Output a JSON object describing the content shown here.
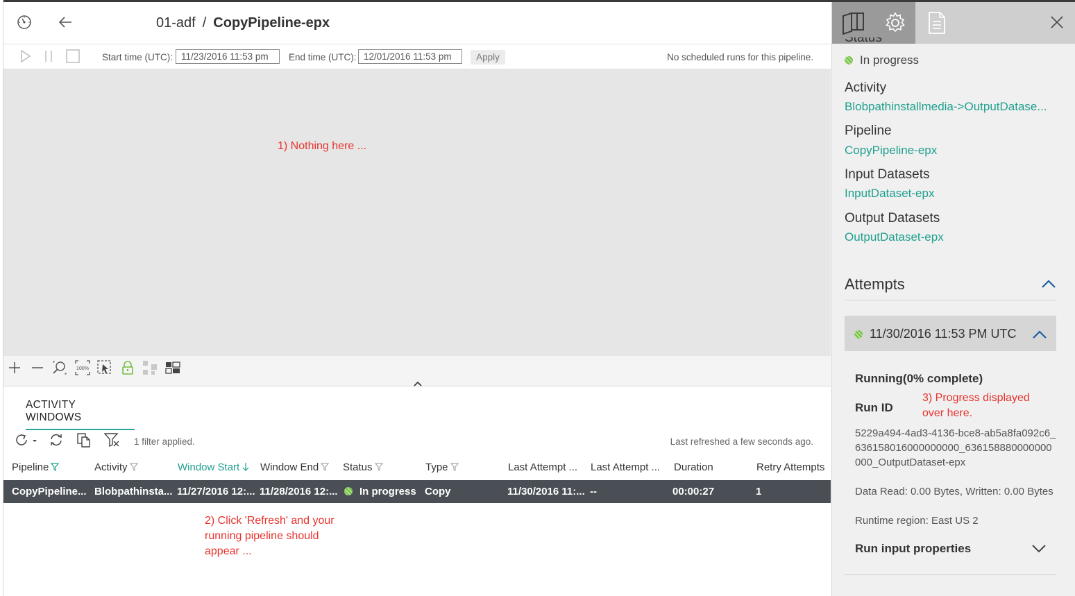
{
  "header": {
    "factory": "01-adf",
    "separator": "/",
    "pipeline": "CopyPipeline-epx"
  },
  "toolbar": {
    "start_label": "Start time (UTC):",
    "start_value": "11/23/2016 11:53 pm",
    "end_label": "End time (UTC):",
    "end_value": "12/01/2016 11:53 pm",
    "apply_label": "Apply",
    "no_runs": "No scheduled runs for this pipeline."
  },
  "annotations": {
    "note1": "1)  Nothing here ...",
    "note2_line1": "2) Click 'Refresh' and your",
    "note2_line2": "running pipeline should",
    "note2_line3": "appear ...",
    "note3_line1": "3)  Progress displayed",
    "note3_line2": "over here."
  },
  "activity_windows": {
    "tab_label": "ACTIVITY WINDOWS",
    "filter_text": "1 filter applied.",
    "refreshed_text": "Last refreshed a few seconds ago.",
    "columns": [
      "Pipeline",
      "Activity",
      "Window Start",
      "Window End",
      "Status",
      "Type",
      "Last Attempt ...",
      "Last Attempt ...",
      "Duration",
      "Retry Attempts"
    ],
    "row": {
      "pipeline": "CopyPipeline...",
      "activity": "Blobpathinsta...",
      "window_start": "11/27/2016 12:...",
      "window_end": "11/28/2016 12:...",
      "status": "In progress",
      "type": "Copy",
      "last_attempt_1": "11/30/2016 11:...",
      "last_attempt_2": "--",
      "duration": "00:00:27",
      "retry_attempts": "1"
    }
  },
  "panel": {
    "status_label": "Status",
    "status_value": "In progress",
    "activity_label": "Activity",
    "activity_value": "Blobpathinstallmedia->OutputDatase...",
    "pipeline_label": "Pipeline",
    "pipeline_value": "CopyPipeline-epx",
    "input_label": "Input Datasets",
    "input_value": "InputDataset-epx",
    "output_label": "Output Datasets",
    "output_value": "OutputDataset-epx",
    "attempts_label": "Attempts",
    "attempt_time": "11/30/2016 11:53 PM UTC",
    "running": "Running(0% complete)",
    "run_id_label": "Run ID",
    "run_id_value": "5229a494-4ad3-4136-bce8-ab5a8fa092c6_636158016000000000_636158880000000000_OutputDataset-epx",
    "data_read": "Data Read: 0.00 Bytes, Written: 0.00 Bytes",
    "runtime_region": "Runtime region: East US 2",
    "run_input_label": "Run input properties"
  },
  "colors": {
    "accent": "#1fa08e",
    "annotation": "#e8322c",
    "selected_row": "#4a4f55",
    "status_green": "#6fbf3f"
  }
}
